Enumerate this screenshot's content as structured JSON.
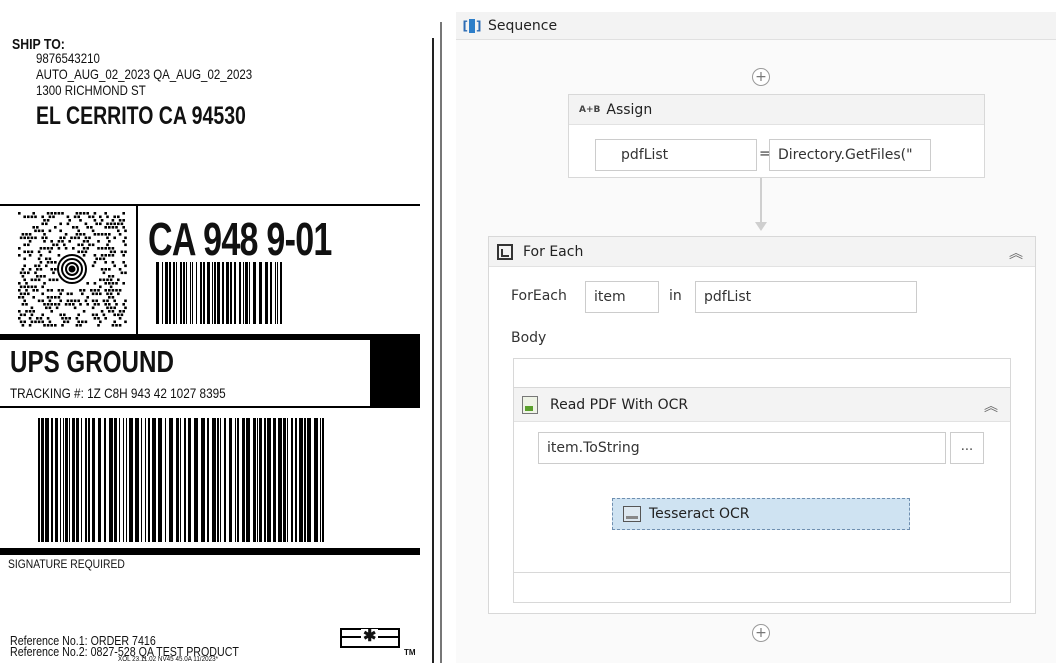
{
  "label": {
    "ship_to": "SHIP TO:",
    "phone": "9876543210",
    "name": "AUTO_AUG_02_2023 QA_AUG_02_2023",
    "street": "1300 RICHMOND ST",
    "city": "EL CERRITO  CA  94530",
    "route_code": "CA 948 9-01",
    "service": "UPS GROUND",
    "tracking": "TRACKING #: 1Z C8H 943 42 1027 8395",
    "signature": "SIGNATURE REQUIRED",
    "reference1": "Reference No.1: ORDER 7416",
    "reference2": "Reference No.2: 0827-528 QA TEST PRODUCT",
    "reference3": "XOL 23.11.02          NV45 45.0A 11/2023*",
    "trademark": "TM"
  },
  "designer": {
    "sequence_title": "Sequence",
    "assign": {
      "title": "Assign",
      "icon_text": "A+B",
      "to": "pdfList",
      "equals": "=",
      "value": "Directory.GetFiles(\""
    },
    "foreach": {
      "title": "For Each",
      "foreach_label": "ForEach",
      "item": "item",
      "in_label": "in",
      "collection": "pdfList",
      "body_label": "Body",
      "collapse": "︽"
    },
    "read_pdf": {
      "title": "Read PDF With OCR",
      "input": "item.ToString",
      "more_button": "...",
      "collapse": "︽",
      "engine": "Tesseract OCR"
    },
    "add_symbol": "+"
  },
  "colors": {
    "selection": "#cfe3f2",
    "header_bg": "#f3f3f3",
    "sequence_icon": "#2d7ec9"
  }
}
